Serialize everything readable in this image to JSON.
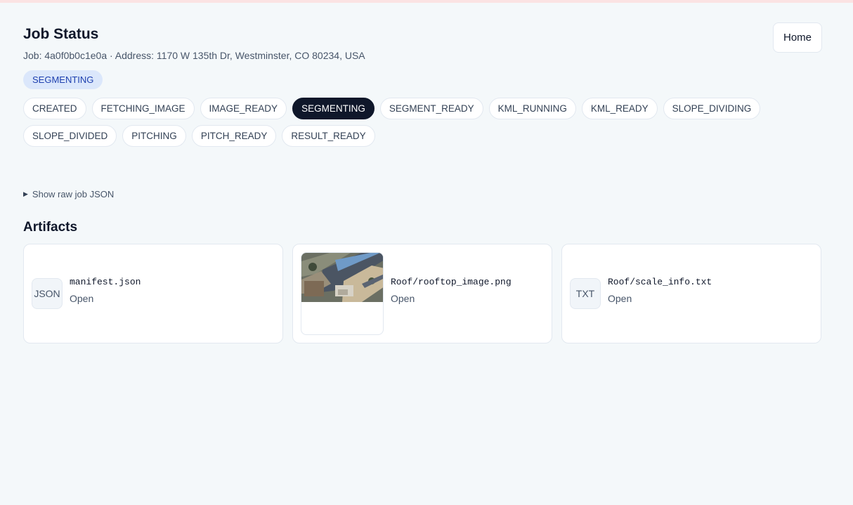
{
  "header": {
    "title": "Job Status",
    "subtitle": "Job: 4a0f0b0c1e0a · Address: 1170 W 135th Dr, Westminster, CO 80234, USA",
    "home_label": "Home",
    "current_status": "SEGMENTING"
  },
  "steps": [
    {
      "label": "CREATED",
      "active": false
    },
    {
      "label": "FETCHING_IMAGE",
      "active": false
    },
    {
      "label": "IMAGE_READY",
      "active": false
    },
    {
      "label": "SEGMENTING",
      "active": true
    },
    {
      "label": "SEGMENT_READY",
      "active": false
    },
    {
      "label": "KML_RUNNING",
      "active": false
    },
    {
      "label": "KML_READY",
      "active": false
    },
    {
      "label": "SLOPE_DIVIDING",
      "active": false
    },
    {
      "label": "SLOPE_DIVIDED",
      "active": false
    },
    {
      "label": "PITCHING",
      "active": false
    },
    {
      "label": "PITCH_READY",
      "active": false
    },
    {
      "label": "RESULT_READY",
      "active": false
    }
  ],
  "raw_toggle": {
    "label": "Show raw job JSON"
  },
  "artifacts": {
    "title": "Artifacts",
    "items": [
      {
        "icon": "JSON",
        "name": "manifest.json",
        "action": "Open"
      },
      {
        "icon": "image",
        "name": "Roof/rooftop_image.png",
        "action": "Open"
      },
      {
        "icon": "TXT",
        "name": "Roof/scale_info.txt",
        "action": "Open"
      }
    ]
  },
  "colors": {
    "background": "#f4f8fa",
    "active_step": "#0f172a",
    "status_badge_bg": "#dbe7fb",
    "status_badge_text": "#1e40af"
  }
}
